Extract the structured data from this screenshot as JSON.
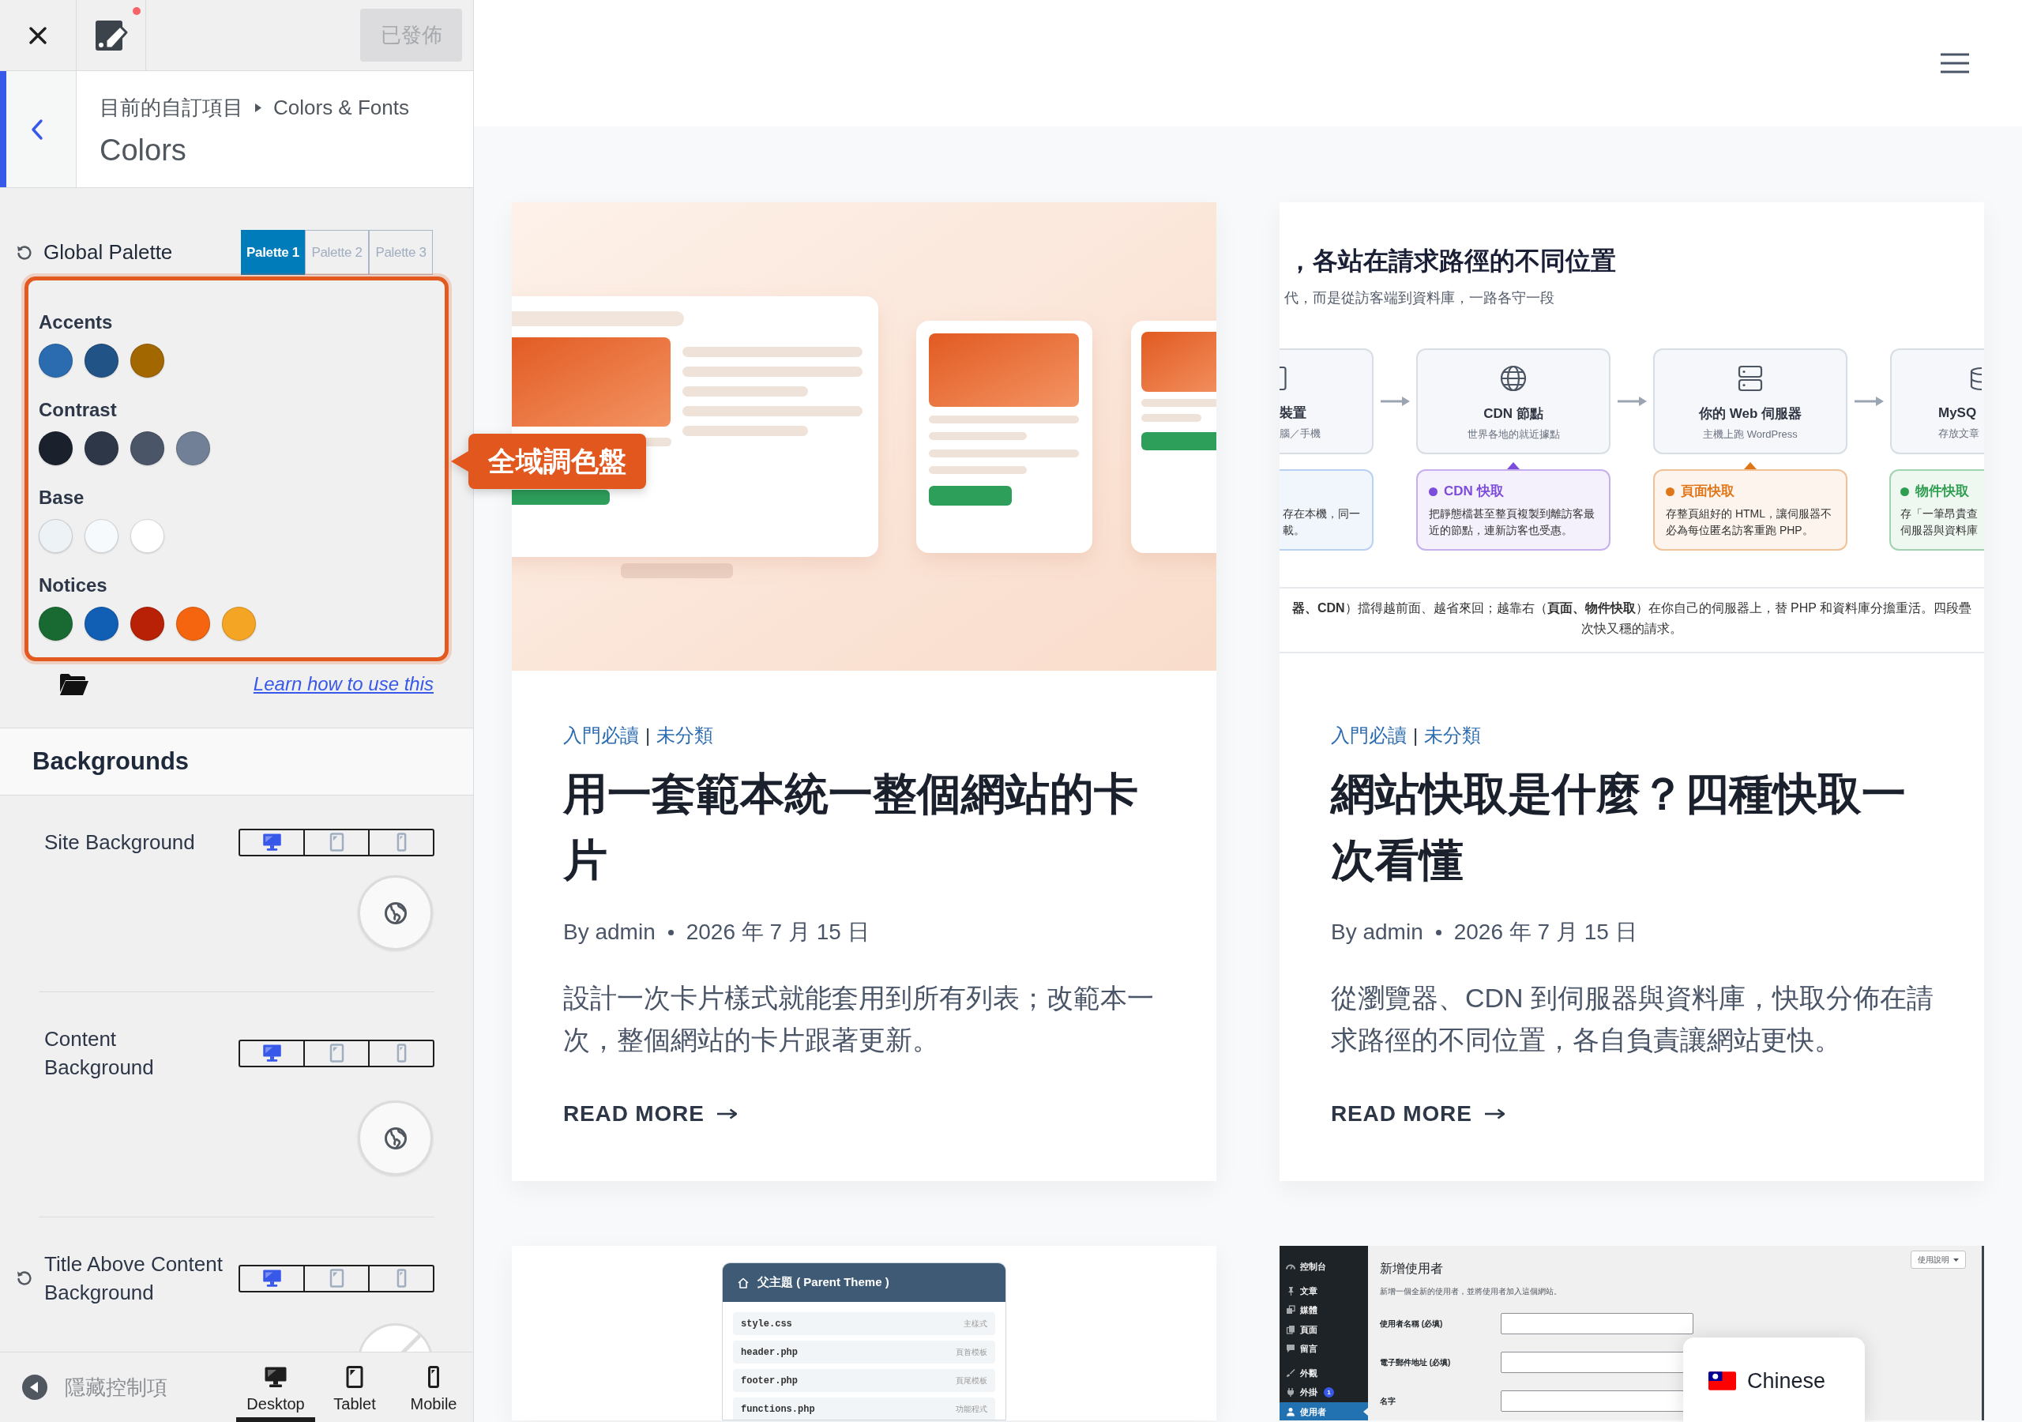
{
  "customizer": {
    "top_bar": {
      "notification": true,
      "publish_button": {
        "label": "已發佈",
        "disabled": true
      }
    },
    "section_header": {
      "breadcrumb": [
        "目前的自訂項目",
        "Colors & Fonts"
      ],
      "title": "Colors"
    },
    "global_palette": {
      "reset": true,
      "label": "Global Palette",
      "palettes": [
        {
          "label": "Palette 1",
          "selected": true
        },
        {
          "label": "Palette 2",
          "selected": false
        },
        {
          "label": "Palette 3",
          "selected": false
        }
      ],
      "groups": [
        {
          "label": "Accents",
          "swatches": [
            {
              "color": "#2b6cb0"
            },
            {
              "color": "#215387"
            },
            {
              "color": "#a36700"
            }
          ]
        },
        {
          "label": "Contrast",
          "swatches": [
            {
              "color": "#1a202c"
            },
            {
              "color": "#2d3748"
            },
            {
              "color": "#4a5568"
            },
            {
              "color": "#718096"
            }
          ]
        },
        {
          "label": "Base",
          "swatches": [
            {
              "color": "#edf2f7"
            },
            {
              "color": "#f7fafc"
            },
            {
              "color": "#ffffff"
            }
          ]
        },
        {
          "label": "Notices",
          "swatches": [
            {
              "color": "#196a32"
            },
            {
              "color": "#105fb5"
            },
            {
              "color": "#b82105"
            },
            {
              "color": "#f5650f"
            },
            {
              "color": "#f5a524"
            }
          ]
        }
      ],
      "help_link": "Learn how to use this"
    },
    "backgrounds": {
      "title": "Backgrounds",
      "settings": [
        {
          "label": "Site Background",
          "reset": false,
          "devices": [
            {
              "kind": "desktop",
              "selected": true
            },
            {
              "kind": "tablet",
              "selected": false
            },
            {
              "kind": "mobile",
              "selected": false
            }
          ],
          "picker": {
            "kind": "global"
          }
        },
        {
          "label": "Content Background",
          "reset": false,
          "devices": [
            {
              "kind": "desktop",
              "selected": true
            },
            {
              "kind": "tablet",
              "selected": false
            },
            {
              "kind": "mobile",
              "selected": false
            }
          ],
          "picker": {
            "kind": "global"
          }
        },
        {
          "label": "Title Above Content Background",
          "reset": true,
          "devices": [
            {
              "kind": "desktop",
              "selected": true
            },
            {
              "kind": "tablet",
              "selected": false
            },
            {
              "kind": "mobile",
              "selected": false
            }
          ],
          "picker": {
            "kind": "none"
          }
        }
      ]
    },
    "footer": {
      "hide_controls": "隱藏控制項",
      "devices": [
        {
          "kind": "desktop",
          "label": "Desktop",
          "selected": true
        },
        {
          "kind": "tablet",
          "label": "Tablet",
          "selected": false
        },
        {
          "kind": "mobile",
          "label": "Mobile",
          "selected": false
        }
      ]
    }
  },
  "annotation": {
    "label": "全域調色盤"
  },
  "preview": {
    "posts": [
      {
        "image": {
          "kind": "mockup"
        },
        "categories": [
          "入門必讀",
          "未分類"
        ],
        "category_separator": "|",
        "title": "用一套範本統一整個網站的卡片",
        "author": "By admin",
        "date": "2026 年 7 月 15 日",
        "excerpt": "設計一次卡片樣式就能套用到所有列表；改範本一次，整個網站的卡片跟著更新。",
        "read_more": "READ MORE"
      },
      {
        "image": {
          "kind": "diagram",
          "title": "，各站在請求路徑的不同位置",
          "subtitle": "代，而是從訪客端到資料庫，一路各守一段",
          "nodes": [
            {
              "kind": "device",
              "name": "裝置",
              "detail": "腦／手機"
            },
            {
              "kind": "globe",
              "name": "CDN 節點",
              "detail": "世界各地的就近據點"
            },
            {
              "kind": "server",
              "name": "你的 Web 伺服器",
              "detail": "主機上跑 WordPress"
            },
            {
              "kind": "database",
              "name": "MySQ",
              "detail": "存放文章"
            }
          ],
          "caches": [
            {
              "color": "#b9d1f3",
              "lines": [
                "存在本機，同一",
                "載。"
              ]
            },
            {
              "color": "#7c4ddb",
              "title": "CDN 快取",
              "text": "把靜態檔甚至整頁複製到離訪客最近的節點，連新訪客也受惠。"
            },
            {
              "color": "#e0761a",
              "title": "頁面快取",
              "text": "存整頁組好的 HTML，讓伺服器不必為每位匿名訪客重跑 PHP。"
            },
            {
              "color": "#2e9e50",
              "title": "物件快取",
              "lines": [
                "存「一筆昂貴查",
                "伺服器與資料庫"
              ]
            }
          ],
          "caption_lines": [
            "**器、CDN**）擋得越前面、越省來回；越靠右（**頁面、物件快取**）在你自己的伺服器上，替 PHP 和資料庫分擔重活。四段疊",
            "次快又穩的請求。"
          ]
        },
        "categories": [
          "入門必讀",
          "未分類"
        ],
        "category_separator": "|",
        "title": "網站快取是什麼？四種快取一次看懂",
        "author": "By admin",
        "date": "2026 年 7 月 15 日",
        "excerpt": "從瀏覽器、CDN 到伺服器與資料庫，快取分佈在請求路徑的不同位置，各自負責讓網站更快。",
        "read_more": "READ MORE"
      },
      {
        "image": {
          "kind": "file-list",
          "title": "父主題 ( Parent Theme )",
          "files": [
            {
              "name": "style.css",
              "description": "主樣式"
            },
            {
              "name": "header.php",
              "description": "頁首模板"
            },
            {
              "name": "footer.php",
              "description": "頁尾模板"
            },
            {
              "name": "functions.php",
              "description": "功能程式"
            }
          ]
        }
      },
      {
        "image": {
          "kind": "admin-screenshot",
          "menu_groups": [
            {
              "items": [
                {
                  "kind": "dashboard",
                  "label": "控制台",
                  "selected": false
                }
              ]
            },
            {
              "items": [
                {
                  "kind": "posts",
                  "label": "文章",
                  "selected": false
                },
                {
                  "kind": "media",
                  "label": "媒體",
                  "selected": false
                },
                {
                  "kind": "pages",
                  "label": "頁面",
                  "selected": false
                },
                {
                  "kind": "comments",
                  "label": "留言",
                  "selected": false
                }
              ]
            },
            {
              "items": [
                {
                  "kind": "appearance",
                  "label": "外觀",
                  "selected": false
                },
                {
                  "kind": "plugins",
                  "label": "外掛",
                  "selected": false,
                  "badge": "1"
                },
                {
                  "kind": "users",
                  "label": "使用者",
                  "selected": true
                }
              ]
            }
          ],
          "page_title": "新增使用者",
          "description": "新增一個全新的使用者，並將使用者加入這個網站。",
          "help_button": "使用說明",
          "fields": [
            {
              "label": "使用者名稱 (必填)"
            },
            {
              "label": "電子郵件地址 (必填)"
            },
            {
              "label": "名字"
            }
          ]
        }
      }
    ],
    "language_switcher": {
      "label": "Chinese"
    }
  }
}
